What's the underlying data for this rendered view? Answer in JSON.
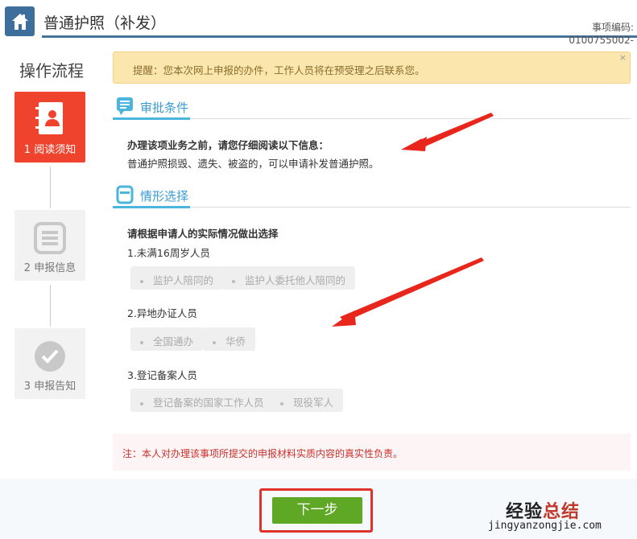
{
  "header": {
    "title": "普通护照（补发）",
    "code_label": "事项编码:",
    "code_value": "0100755002-"
  },
  "sidebar": {
    "title": "操作流程",
    "steps": [
      {
        "label": "1 阅读须知",
        "icon": "contact-book-icon",
        "active": true
      },
      {
        "label": "2 申报信息",
        "icon": "list-doc-icon",
        "active": false
      },
      {
        "label": "3 申报告知",
        "icon": "check-circle-icon",
        "active": false
      }
    ]
  },
  "alert": {
    "text": "提醒：您本次网上申报的办件，工作人员将在预受理之后联系您。",
    "close": "×"
  },
  "conditions": {
    "title": "审批条件",
    "heading": "办理该项业务之前，请您仔细阅读以下信息：",
    "body": "普通护照损毁、遗失、被盗的，可以申请补发普通护照。"
  },
  "situation": {
    "title": "情形选择",
    "prompt": "请根据申请人的实际情况做出选择",
    "groups": [
      {
        "label": "1.未满16周岁人员",
        "options": [
          "监护人陪同的",
          "监护人委托他人陪同的"
        ]
      },
      {
        "label": "2.异地办证人员",
        "options": [
          "全国通办",
          "华侨"
        ]
      },
      {
        "label": "3.登记备案人员",
        "options": [
          "登记备案的国家工作人员",
          "现役军人"
        ]
      }
    ]
  },
  "note": "注：本人对办理该事项所提交的申报材料实质内容的真实性负责。",
  "footer": {
    "next_label": "下一步"
  },
  "watermark": {
    "cn_a": "经验",
    "cn_b": "总结",
    "url": "jingyanzongjie.com"
  },
  "colors": {
    "accent": "#3e6f9c",
    "active_step": "#f0432e",
    "next": "#5ea826",
    "section": "#3a9bd0"
  }
}
